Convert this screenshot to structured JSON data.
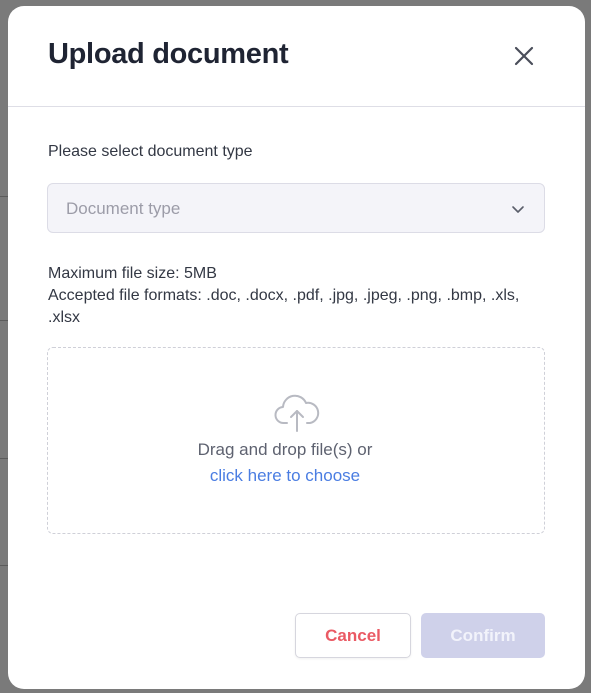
{
  "dialog": {
    "title": "Upload document",
    "close_icon": "close-icon"
  },
  "document_type": {
    "label": "Please select document type",
    "placeholder": "Document type",
    "dropdown_icon": "chevron-down-icon"
  },
  "file_info": {
    "max_size": "Maximum file size: 5MB",
    "accepted_formats": "Accepted file formats: .doc, .docx, .pdf, .jpg, .jpeg, .png, .bmp, .xls, .xlsx"
  },
  "dropzone": {
    "icon": "cloud-upload-icon",
    "text": "Drag and drop file(s) or",
    "link": "click here to choose"
  },
  "actions": {
    "cancel_label": "Cancel",
    "confirm_label": "Confirm"
  },
  "colors": {
    "title": "#1f2433",
    "link": "#4a7de2",
    "cancel_text": "#ea5a64",
    "confirm_bg_disabled": "#cfd1ea",
    "backdrop": "#7a7a7a"
  }
}
